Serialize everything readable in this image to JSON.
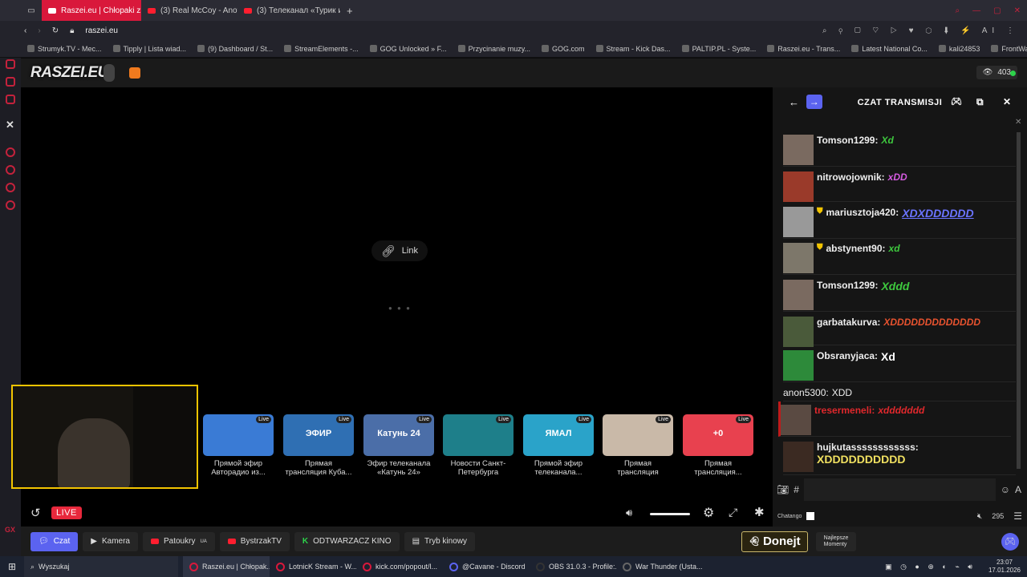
{
  "browser": {
    "tabs": [
      {
        "label": "Raszei.eu | Chłopaki z Ra:",
        "active": true
      },
      {
        "label": "(3) Real McCoy - Another",
        "active": false
      },
      {
        "label": "(3) Телеканал «Турик и К",
        "active": false
      }
    ],
    "address": "raszei.eu",
    "bookmarks": [
      "Strumyk.TV - Mec...",
      "Tipply | Lista wiad...",
      "(9) Dashboard / St...",
      "StreamElements -...",
      "GOG Unlocked » F...",
      "Przycinanie muzy...",
      "GOG.com",
      "Stream - Kick Das...",
      "PALTIP.PL - Syste...",
      "Raszei.eu - Trans...",
      "Latest National Co...",
      "kali24853",
      "FrontWars"
    ]
  },
  "site": {
    "logo": "RASZEI.EU",
    "viewer_count": "403"
  },
  "player": {
    "link_label": "Link",
    "live_label": "LIVE",
    "cards": [
      {
        "title": "Прямой эфир\nАвторадио из...",
        "live": "Live",
        "thumb_text": "",
        "color": "#3a7bd5"
      },
      {
        "title": "Прямая\nтрансляция Куба...",
        "live": "Live",
        "thumb_text": "ЭФИР",
        "color": "#2f6fb3"
      },
      {
        "title": "Эфир телеканала\n«Катунь 24»",
        "live": "Live",
        "thumb_text": "Катунь 24",
        "color": "#4b6ea8"
      },
      {
        "title": "Новости Санкт-\nПетербурга",
        "live": "Live",
        "thumb_text": "",
        "color": "#1e7f8a"
      },
      {
        "title": "Прямой эфир\nтелеканала...",
        "live": "Live",
        "thumb_text": "ЯМАЛ",
        "color": "#2aa3c9"
      },
      {
        "title": "Прямая\nтрансляция",
        "live": "Live",
        "thumb_text": "",
        "color": "#c9b9a8"
      },
      {
        "title": "Прямая\nтрансляция...",
        "live": "Live",
        "thumb_text": "+0",
        "color": "#e8414f"
      }
    ]
  },
  "chat": {
    "title": "CZAT TRANSMISJI",
    "messages": [
      {
        "user": "Tomson1299:",
        "text": "Xd",
        "text_color": "#3ec93e",
        "avatar": "#7a6a60"
      },
      {
        "user": "nitrowojownik:",
        "text": "xDD",
        "text_color": "#d55be0",
        "avatar": "#9a3a2a"
      },
      {
        "user": "mariusztoja420:",
        "text": "XDXDDDDDD",
        "text_color": "#6a73ff",
        "avatar": "#999"
      },
      {
        "user": "abstynent90:",
        "text": "xd",
        "text_color": "#3ec93e",
        "avatar": "#7d776a"
      },
      {
        "user": "Tomson1299:",
        "text": "Xddd",
        "text_color": "#3ec93e",
        "avatar": "#7a6a60"
      },
      {
        "user": "garbatakurva:",
        "text": "XDDDDDDDDDDDDD",
        "text_color": "#e8532f",
        "avatar": "#4a5a3a"
      },
      {
        "user": "Obsranyjaca:",
        "text": "Xd",
        "text_color": "#ffffff",
        "avatar": "#2d8a3a"
      },
      {
        "user": "anon5300:",
        "text": "XDD",
        "text_color": "#eeeeee",
        "avatar": ""
      },
      {
        "user": "tresermeneli:",
        "text": "xddddddd",
        "text_color": "#e0282c",
        "avatar": "#5a4a42"
      },
      {
        "user": "hujkutassssssssssss:",
        "text": "XDDDDDDDDDD",
        "text_color": "#f0e060",
        "avatar": "#3b2a22"
      }
    ],
    "input_hash": "#",
    "footer_brand": "Chatango",
    "online_count": "295"
  },
  "nav": {
    "czat": "Czat",
    "kamera": "Kamera",
    "patoukry": "Patoukry",
    "patoukry_sup": "UA",
    "bystrzak": "BystrzakTV",
    "kino": "ODTWARZACZ KINO",
    "tryb": "Tryb kinowy",
    "donejt": "Donejt",
    "najlepsze": "Najlepsze\nMomenty"
  },
  "taskbar": {
    "search": "Wyszukaj",
    "items": [
      "Raszei.eu | Chłopak...",
      "LotnicK Stream - W...",
      "kick.com/popout/l...",
      "@Cavane - Discord",
      "OBS 31.0.3 - Profile:...",
      "War Thunder (Usta..."
    ],
    "time": "23:07",
    "date": "17.01.2026"
  },
  "colors": {
    "accent": "#5b63f0",
    "live": "#e8283c",
    "opera": "#d9183b",
    "cam_border": "#f2c400"
  }
}
